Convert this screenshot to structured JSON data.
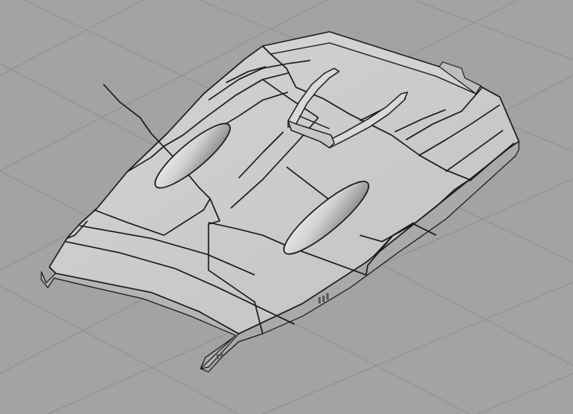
{
  "viewport": {
    "background_color": "#a3a3a3",
    "grid_color": "#8f8f8f",
    "model_fill": "#c9c9c9",
    "model_edge": "#1a1a1a",
    "model_shadow": "#8c8c8c"
  }
}
